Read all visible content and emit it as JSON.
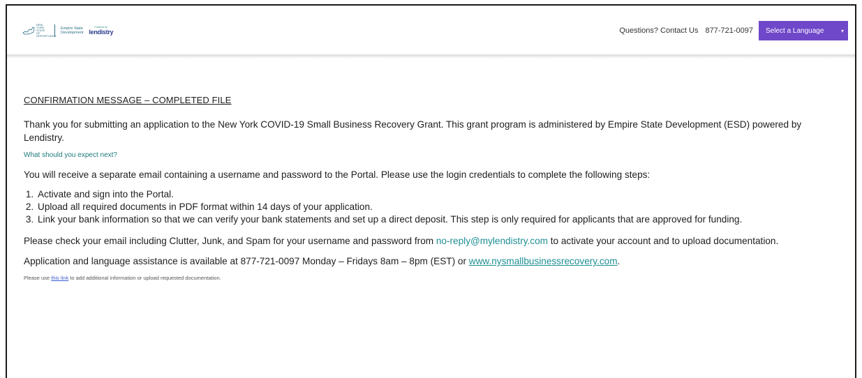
{
  "header": {
    "ny_logo_text": "NEW YORK STATE OF OPPORTUNITY",
    "esd_logo_line1": "Empire State",
    "esd_logo_line2": "Development",
    "powered_by": "Powered by",
    "lendistry": "lendistry",
    "contact_text": "Questions? Contact Us",
    "contact_phone": "877-721-0097",
    "language_button": "Select a Language"
  },
  "main": {
    "title": "CONFIRMATION MESSAGE – COMPLETED FILE",
    "thanks": "Thank you for submitting an application to the New York COVID-19 Small Business Recovery Grant. This grant program is administered by Empire State Development (ESD) powered by Lendistry.",
    "expect_heading": "What should you expect next?",
    "email_intro": "You will receive a separate email containing a username and password to the Portal. Please use the login credentials to complete the following steps:",
    "steps": [
      "Activate and sign into the Portal.",
      "Upload all required documents in PDF format within 14 days of your application.",
      "Link your bank information so that we can verify your bank statements and set up a direct deposit. This step is only required for applicants that are approved for funding."
    ],
    "check_email_pre": "Please check your email including Clutter, Junk, and Spam for your username and password from ",
    "check_email_link": "no-reply@mylendistry.com",
    "check_email_post": " to activate your account and to upload documentation.",
    "assist_pre": "Application and language assistance is available at 877-721-0097 Monday – Fridays 8am – 8pm (EST) or ",
    "assist_link": "www.nysmallbusinessrecovery.com",
    "assist_post": ".",
    "note_pre": "Please use ",
    "note_link": "this link",
    "note_post": " to add additional information or upload requested documentation."
  },
  "colors": {
    "accent_purple": "#6f47c9",
    "link_teal": "#1f8f94"
  }
}
